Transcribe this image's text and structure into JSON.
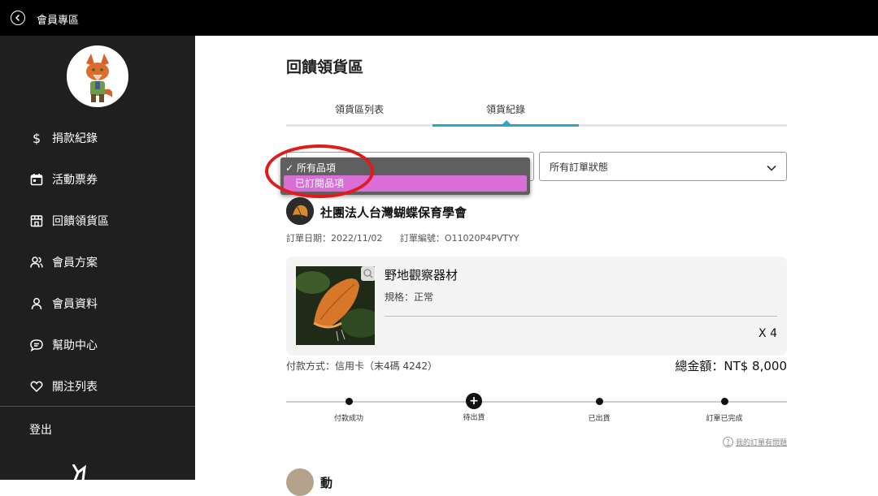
{
  "topbar": {
    "title": "會員專區",
    "back_icon": "back-arrow-icon"
  },
  "sidebar": {
    "items": [
      {
        "label": "捐款紀錄",
        "icon": "dollar-icon"
      },
      {
        "label": "活動票券",
        "icon": "calendar-icon"
      },
      {
        "label": "回饋領貨區",
        "icon": "store-icon"
      },
      {
        "label": "會員方案",
        "icon": "users-icon"
      },
      {
        "label": "會員資料",
        "icon": "user-icon"
      },
      {
        "label": "幫助中心",
        "icon": "chat-icon"
      },
      {
        "label": "關注列表",
        "icon": "heart-icon"
      }
    ],
    "logout": "登出"
  },
  "main": {
    "title": "回饋領貨區",
    "tabs": [
      {
        "label": "領貨區列表",
        "active": false
      },
      {
        "label": "領貨紀錄",
        "active": true
      }
    ],
    "filters": {
      "item_filter": {
        "options": [
          "所有品項",
          "已訂閱品項"
        ],
        "checked_prefix": "✓",
        "highlighted_index": 1
      },
      "status_filter": {
        "value": "所有訂單狀態"
      }
    },
    "order": {
      "org_name": "社團法人台灣蝴蝶保育學會",
      "order_date": "訂單日期：2022/11/02",
      "order_no": "訂單編號：O11020P4PVTYY",
      "item": {
        "name": "野地觀察器材",
        "spec": "規格：正常",
        "qty": "X 4"
      },
      "payment": "付款方式：信用卡（末4碼 4242）",
      "total": "總金額：NT$ 8,000",
      "steps": [
        {
          "label": "付款成功",
          "current": false
        },
        {
          "label": "待出貨",
          "current": true
        },
        {
          "label": "已出貨",
          "current": false
        },
        {
          "label": "訂單已完成",
          "current": false
        }
      ],
      "help_link": "我的訂單有問題"
    },
    "next_order": {
      "org_name": "動"
    }
  },
  "colors": {
    "accent": "#2aa7c4",
    "highlight": "#d86ed6",
    "annotation": "#e11b1b",
    "sidebar_bg": "#1f1f1f"
  }
}
